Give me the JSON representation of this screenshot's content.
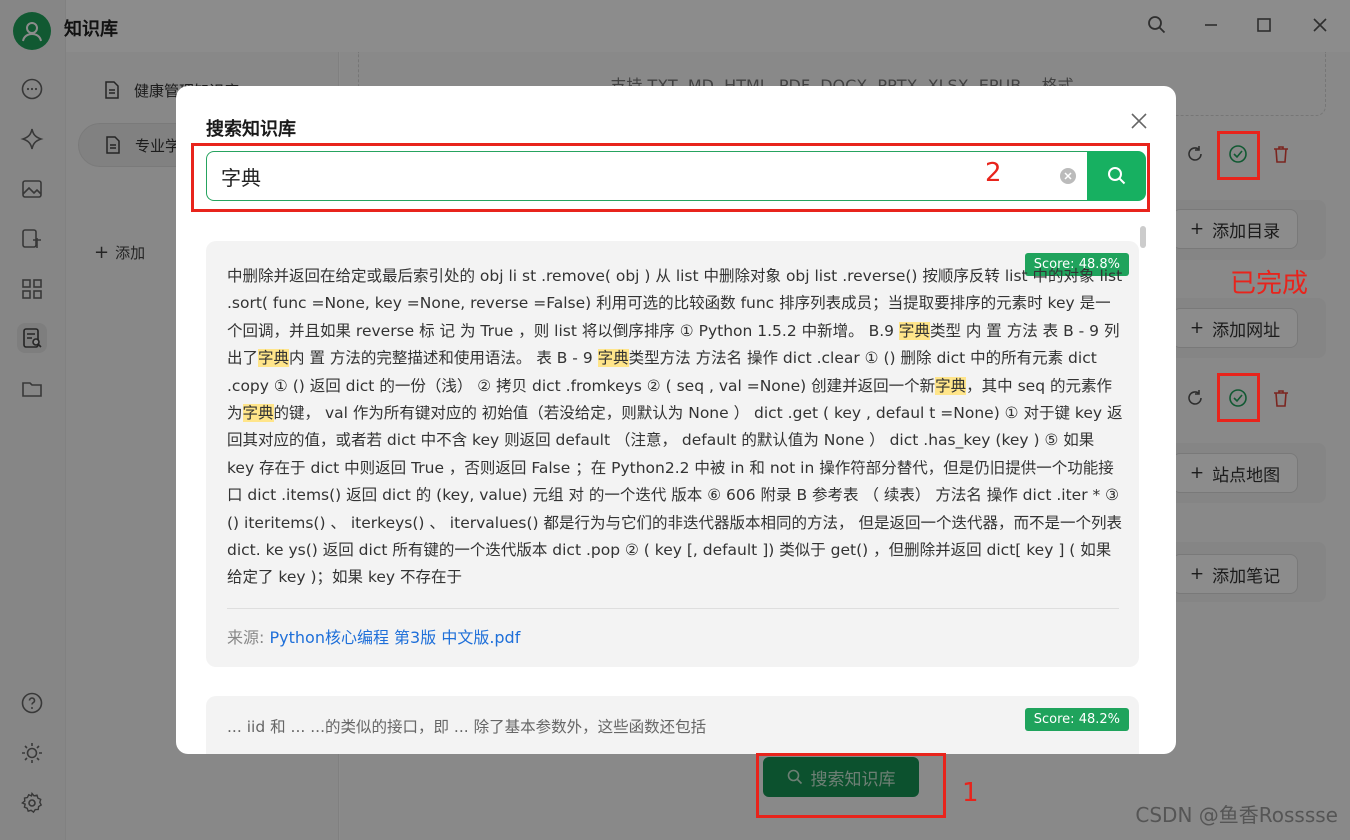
{
  "app": {
    "title": "知识库"
  },
  "knowledge_bases": [
    {
      "label": "健康管理知识库"
    },
    {
      "label": "专业学习"
    }
  ],
  "kb_add_label": "添加",
  "main": {
    "dropzone_hint": "支持 TXT, MD, HTML, PDF, DOCX, PPTX, XLSX, EPUB... 格式",
    "add_buttons": [
      "添加目录",
      "添加网址",
      "站点地图",
      "添加笔记"
    ],
    "search_kb_button": "搜索知识库"
  },
  "annotations": {
    "done": "已完成",
    "step1": "1",
    "step2": "2"
  },
  "watermark": "CSDN @鱼香Rosssse",
  "modal": {
    "title": "搜索知识库",
    "query": "字典",
    "results": [
      {
        "score": "Score: 48.8%",
        "source_label": "来源:",
        "source_file": "Python核心编程 第3版 中文版.pdf"
      },
      {
        "score": "Score: 48.2%",
        "preview": "... iid 和 ... ...的类似的接口，即 ... 除了基本参数外，这些函数还包括"
      }
    ]
  },
  "colors": {
    "accent": "#17b061",
    "highlight": "#ffe58a",
    "annotation": "#e8241c"
  }
}
